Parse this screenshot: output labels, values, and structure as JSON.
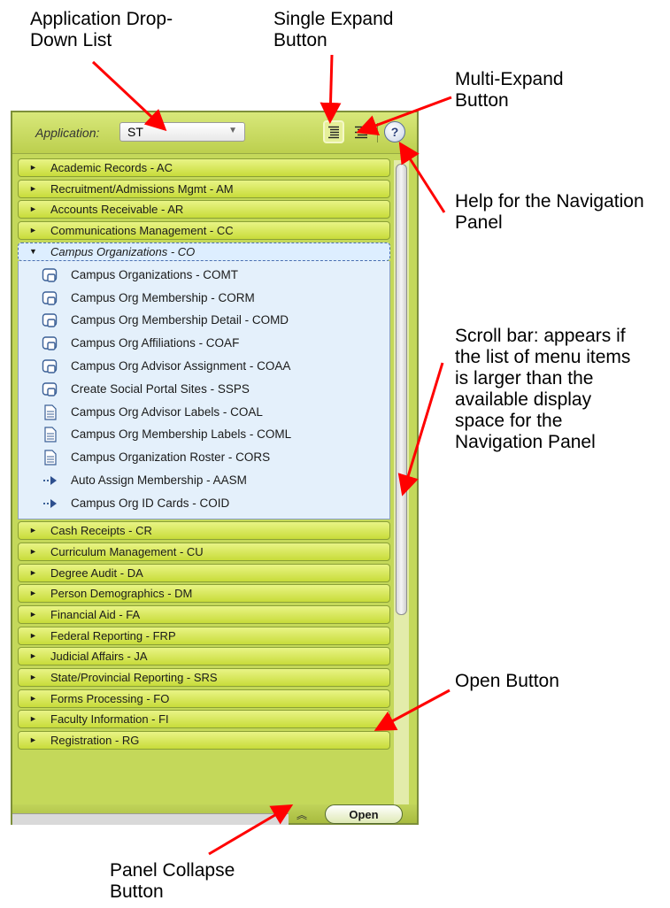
{
  "callouts": {
    "app_dropdown": [
      "Application Drop-",
      "Down List"
    ],
    "single_expand": [
      "Single Expand",
      "Button"
    ],
    "multi_expand": [
      "Multi-Expand",
      "Button"
    ],
    "help": [
      "Help for the Navigation",
      "Panel"
    ],
    "scrollbar": [
      "Scroll bar: appears if",
      "the list of menu items",
      "is larger than the",
      "available display",
      "space for the",
      "Navigation Panel"
    ],
    "open": [
      "Open Button"
    ],
    "collapse": [
      "Panel Collapse",
      "Button"
    ]
  },
  "panel": {
    "app_label": "Application:",
    "app_value": "ST",
    "help_glyph": "?",
    "open_label": "Open",
    "collapse_glyph": "≈",
    "categories": [
      {
        "label": "Academic Records - AC",
        "expanded": false
      },
      {
        "label": "Recruitment/Admissions Mgmt - AM",
        "expanded": false
      },
      {
        "label": "Accounts Receivable - AR",
        "expanded": false
      },
      {
        "label": "Communications Management - CC",
        "expanded": false
      },
      {
        "label": "Campus Organizations - CO",
        "expanded": true,
        "items": [
          {
            "label": "Campus Organizations - COMT",
            "icon": "form-icon"
          },
          {
            "label": "Campus Org Membership - CORM",
            "icon": "form-icon"
          },
          {
            "label": "Campus Org Membership Detail - COMD",
            "icon": "form-icon"
          },
          {
            "label": "Campus Org Affiliations - COAF",
            "icon": "form-icon"
          },
          {
            "label": "Campus Org Advisor Assignment - COAA",
            "icon": "form-icon"
          },
          {
            "label": "Create Social Portal Sites - SSPS",
            "icon": "form-icon"
          },
          {
            "label": "Campus Org Advisor Labels - COAL",
            "icon": "report-icon"
          },
          {
            "label": "Campus Org Membership Labels - COML",
            "icon": "report-icon"
          },
          {
            "label": "Campus Organization Roster - CORS",
            "icon": "report-icon"
          },
          {
            "label": "Auto Assign Membership - AASM",
            "icon": "process-icon"
          },
          {
            "label": "Campus Org ID Cards - COID",
            "icon": "process-icon"
          }
        ]
      },
      {
        "label": "Cash Receipts - CR",
        "expanded": false
      },
      {
        "label": "Curriculum Management - CU",
        "expanded": false
      },
      {
        "label": "Degree Audit - DA",
        "expanded": false
      },
      {
        "label": "Person Demographics - DM",
        "expanded": false
      },
      {
        "label": "Financial Aid - FA",
        "expanded": false
      },
      {
        "label": "Federal Reporting - FRP",
        "expanded": false
      },
      {
        "label": "Judicial Affairs - JA",
        "expanded": false
      },
      {
        "label": "State/Provincial Reporting - SRS",
        "expanded": false
      },
      {
        "label": "Forms Processing - FO",
        "expanded": false
      },
      {
        "label": "Faculty Information - FI",
        "expanded": false
      },
      {
        "label": "Registration - RG",
        "expanded": false
      }
    ]
  },
  "colors": {
    "panel_green": "#c4d85a",
    "selected_blue": "#e4f0fb",
    "arrow_red": "#ff0000"
  }
}
